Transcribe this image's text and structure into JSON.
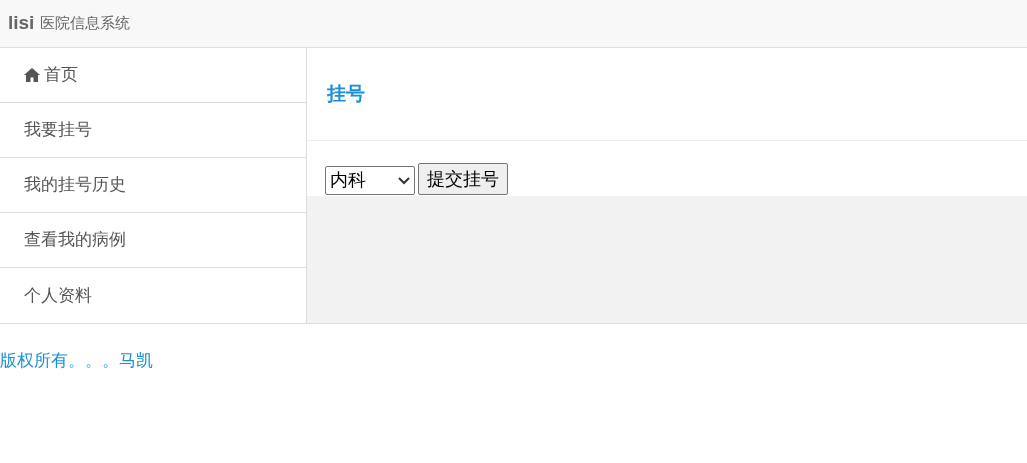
{
  "navbar": {
    "brand": "lisi",
    "subtitle": "医院信息系统"
  },
  "sidebar": {
    "items": [
      {
        "label": "首页",
        "kind": "home"
      },
      {
        "label": "我要挂号",
        "kind": "plain"
      },
      {
        "label": "我的挂号历史",
        "kind": "plain"
      },
      {
        "label": "查看我的病例",
        "kind": "plain"
      },
      {
        "label": "个人资料",
        "kind": "plain"
      }
    ]
  },
  "content": {
    "title": "挂号",
    "department_select": {
      "value": "内科"
    },
    "submit_button": "提交挂号"
  },
  "footer": {
    "text": "版权所有。。。马凯"
  }
}
